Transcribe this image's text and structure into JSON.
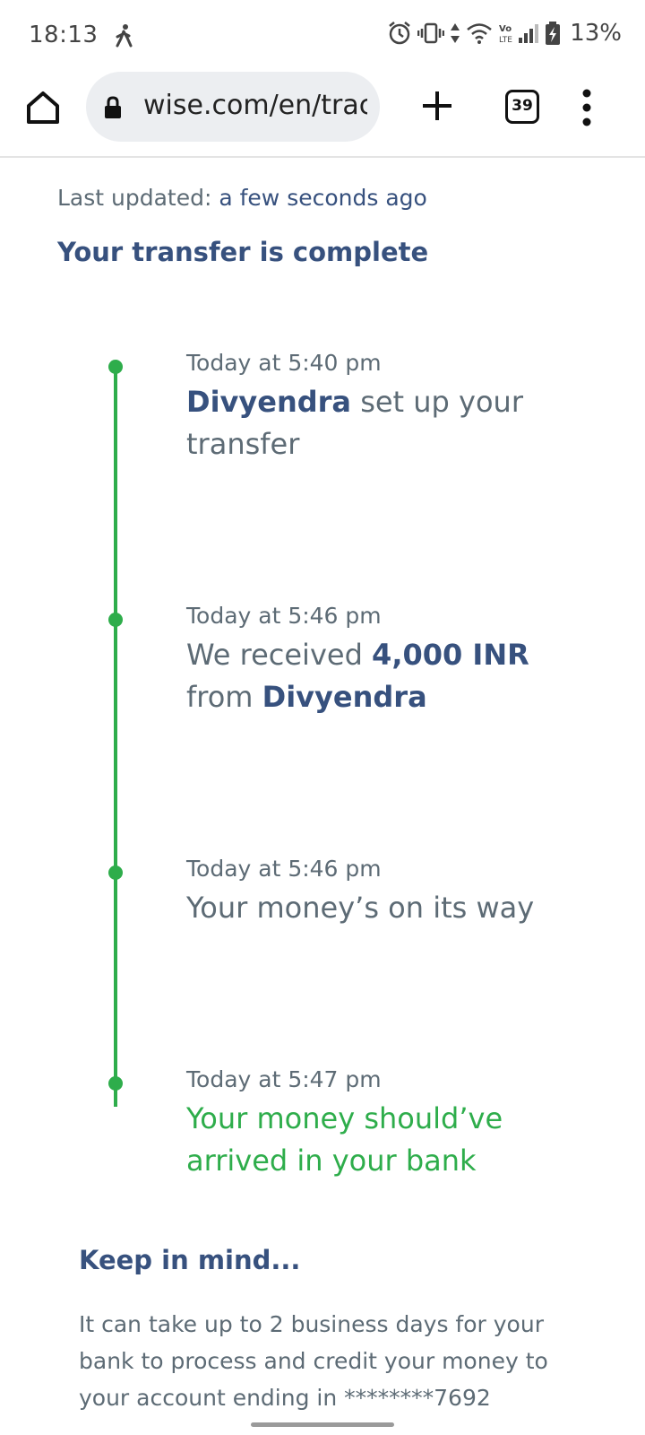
{
  "status_bar": {
    "time": "18:13",
    "battery_percent": "13%",
    "icons": [
      "walking-icon",
      "alarm-icon",
      "vibrate-icon",
      "data-arrows-icon",
      "wifi-icon",
      "volte-icon",
      "signal-icon",
      "battery-charging-icon"
    ]
  },
  "browser": {
    "url": "wise.com/en/trac",
    "tab_count": "39",
    "icons": [
      "home-icon",
      "lock-icon",
      "plus-icon",
      "tabs-icon",
      "more-vert-icon"
    ]
  },
  "page": {
    "last_updated_label": "Last updated: ",
    "last_updated_value": "a few seconds ago",
    "headline": "Your transfer is complete",
    "timeline": [
      {
        "time": "Today at 5:40 pm",
        "name": "Divyendra",
        "text": " set up your transfer"
      },
      {
        "time": "Today at 5:46 pm",
        "text_pre": "We received ",
        "amount": "4,000 INR",
        "text_mid": " from ",
        "name": "Divyendra"
      },
      {
        "time": "Today at 5:46 pm",
        "text": "Your money’s on its way"
      },
      {
        "time": "Today at 5:47 pm",
        "text": "Your money should’ve arrived in your bank"
      }
    ],
    "keep_in_mind_title": "Keep in mind...",
    "keep_in_mind_body": "It can take up to 2 business days for your bank to process and credit your money to your account ending in ********7692"
  },
  "colors": {
    "accent_navy": "#37517e",
    "success_green": "#2ead4b",
    "body_gray": "#5d6b75"
  }
}
